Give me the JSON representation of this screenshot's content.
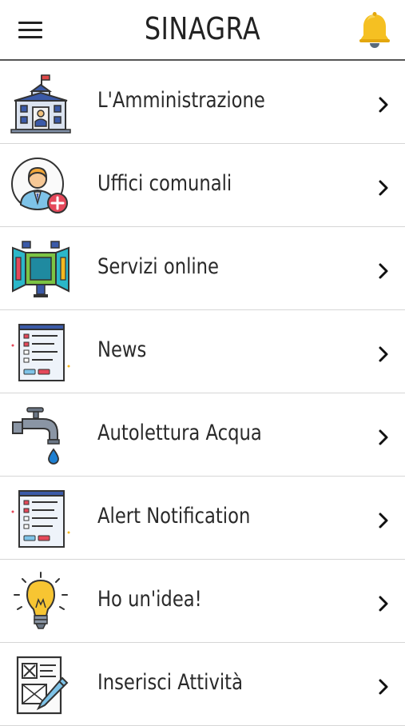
{
  "header": {
    "title": "SINAGRA",
    "menu_icon": "hamburger-menu-icon",
    "notification_icon": "bell-icon",
    "bell_color": "#F5C022"
  },
  "menu": {
    "items": [
      {
        "label": "L'Amministrazione",
        "icon": "town-hall-icon"
      },
      {
        "label": "Uffici comunali",
        "icon": "office-clerk-icon"
      },
      {
        "label": "Servizi online",
        "icon": "web-services-icon"
      },
      {
        "label": "News",
        "icon": "news-document-icon"
      },
      {
        "label": "Autolettura Acqua",
        "icon": "water-tap-icon"
      },
      {
        "label": "Alert Notification",
        "icon": "alert-document-icon"
      },
      {
        "label": "Ho un'idea!",
        "icon": "lightbulb-icon"
      },
      {
        "label": "Inserisci Attività",
        "icon": "form-edit-icon"
      }
    ]
  }
}
